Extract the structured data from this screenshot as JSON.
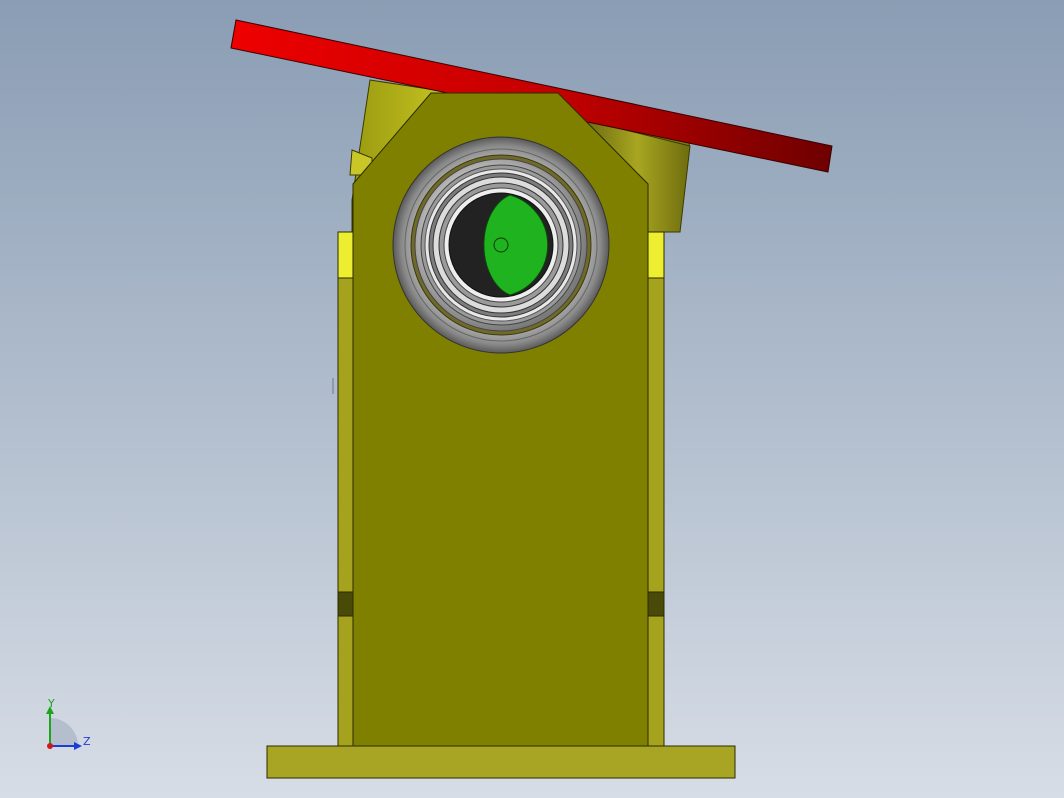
{
  "viewport": {
    "background_top": "#8a9db4",
    "background_bottom": "#d7dde6"
  },
  "colors": {
    "body_olive": "#808000",
    "body_side": "#a8a61e",
    "body_edge": "#2b2b00",
    "highlight_yellow": "#e8e838",
    "handle_red": "#e00000",
    "handle_dark": "#7a0000",
    "ball_green": "#1fb41f",
    "ring_grey": "#8c8c8c",
    "ring_dark": "#555555",
    "bore_dark": "#222222",
    "base_olive": "#a8a424"
  },
  "triad": {
    "y_label": "Y",
    "z_label": "Z",
    "y_color": "#1ca51c",
    "z_color": "#1c3cd8",
    "origin_color": "#d01818"
  }
}
